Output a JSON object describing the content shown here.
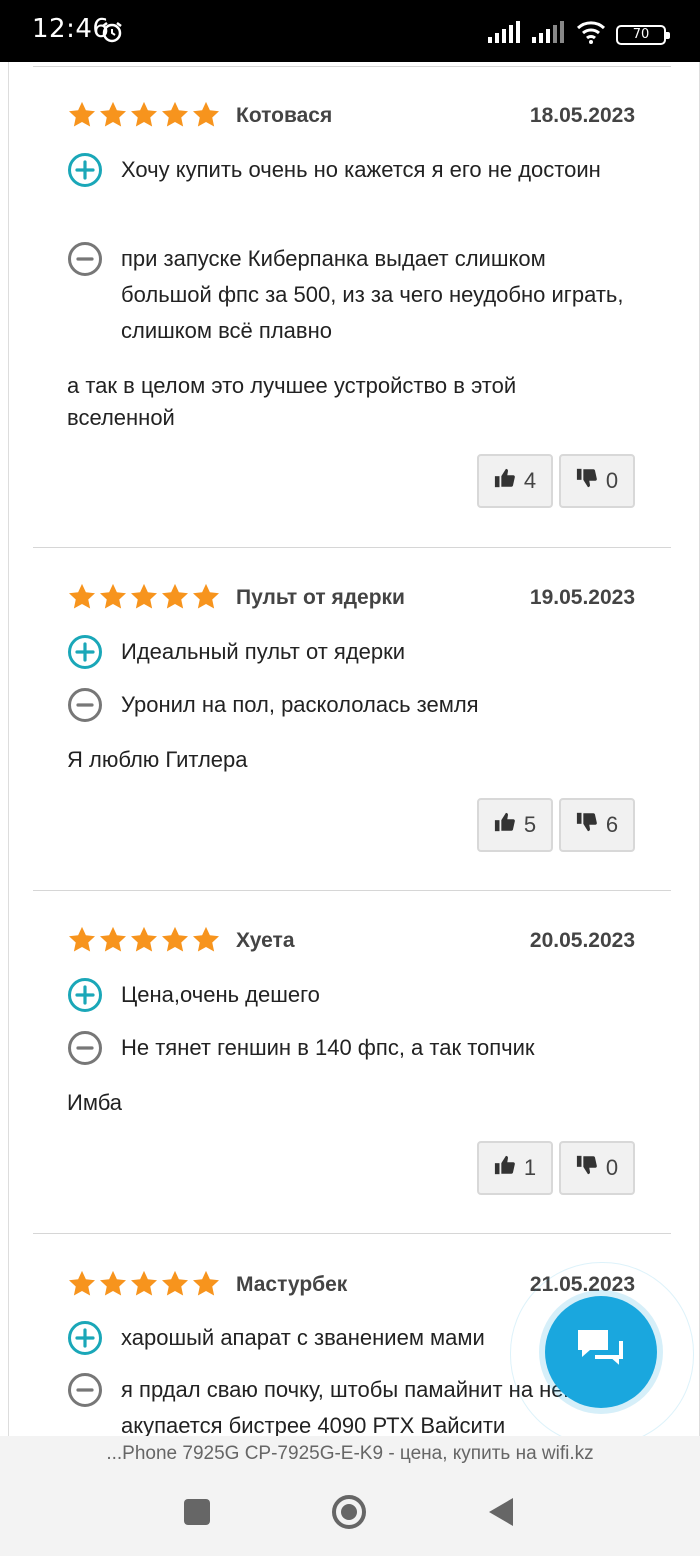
{
  "status_bar": {
    "time": "12:46",
    "battery": "70"
  },
  "reviews": [
    {
      "rating": 5,
      "author": "Котовася",
      "date": "18.05.2023",
      "pro": "Хочу купить очень но кажется я его не достоин",
      "con": "при запуске Киберпанка выдает слишком большой фпс за 500, из за чего неудобно играть, слишком всё плавно",
      "comment": "а так в целом это лучшее устройство в этой вселенной",
      "likes": "4",
      "dislikes": "0"
    },
    {
      "rating": 5,
      "author": "Пульт от ядерки",
      "date": "19.05.2023",
      "pro": "Идеальный пульт от ядерки",
      "con": "Уронил на пол, раскололась земля",
      "comment": "Я люблю Гитлера",
      "likes": "5",
      "dislikes": "6"
    },
    {
      "rating": 5,
      "author": "Хуета",
      "date": "20.05.2023",
      "pro": "Цена,очень дешего",
      "con": "Не тянет геншин в 140 фпс, а так топчик",
      "comment": "Имба",
      "likes": "1",
      "dislikes": "0"
    },
    {
      "rating": 5,
      "author": "Мастурбек",
      "date": "21.05.2023",
      "pro": "харошый апарат с званением мами",
      "con": "я прдал сваю почку, штобы памайнит на нем. акупается бистрее 4090 РТХ Вайсити"
    }
  ],
  "browser": {
    "page_title": "...Phone 7925G CP-7925G-E-K9 - цена, купить на wifi.kz"
  },
  "colors": {
    "star": "#f7941d",
    "pro_icon": "#1aa7b8",
    "con_icon": "#777777",
    "chat_button": "#1aa7de"
  },
  "icons": {
    "pro": "plus-circle-icon",
    "con": "minus-circle-icon",
    "like": "thumbs-up-icon",
    "dislike": "thumbs-down-icon",
    "chat": "chat-bubbles-icon"
  }
}
